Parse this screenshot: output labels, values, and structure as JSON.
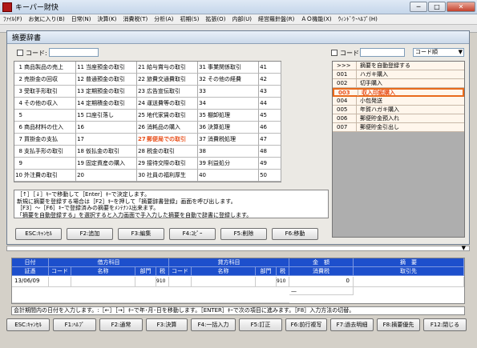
{
  "window": {
    "title": "キーパー財快"
  },
  "menu": [
    "ﾌｧｲﾙ(F)",
    "お気に入り(B)",
    "日常(N)",
    "決算(K)",
    "消費税(T)",
    "分析(A)",
    "初期(S)",
    "拡張(O)",
    "内部(U)",
    "経営羅針盤(R)",
    "ＡＯ機能(X)",
    "ｳｨﾝﾄﾞｳ･ﾍﾙﾌﾟ(H)"
  ],
  "dialog": {
    "title": "摘要辞書",
    "code_label": "コード:",
    "code_value": "",
    "right_code_label": "コード:",
    "right_code_value": "",
    "sort_select": "コード順",
    "grid": [
      [
        "1",
        "商品製品の売上",
        "11",
        "当座預金の取引",
        "21",
        "給与賞与の取引",
        "31",
        "事業関係取引",
        "41",
        ""
      ],
      [
        "2",
        "売掛金の回収",
        "12",
        "普通預金の取引",
        "22",
        "旅費交通費取引",
        "32",
        "その他の経費",
        "42",
        ""
      ],
      [
        "3",
        "受取手形取引",
        "13",
        "定期預金の取引",
        "23",
        "広告宣伝取引",
        "33",
        "",
        "43",
        ""
      ],
      [
        "4",
        "その他の収入",
        "14",
        "定期積金の取引",
        "24",
        "運送費等の取引",
        "34",
        "",
        "44",
        ""
      ],
      [
        "5",
        "",
        "15",
        "口座引落し",
        "25",
        "地代家賃の取引",
        "35",
        "棚卸処理",
        "45",
        ""
      ],
      [
        "6",
        "商品材料の仕入",
        "16",
        "",
        "26",
        "消耗品の購入",
        "36",
        "決算処理",
        "46",
        ""
      ],
      [
        "7",
        "買掛金の支払",
        "17",
        "",
        "27",
        "郵便局での取引",
        "37",
        "消費税処理",
        "47",
        ""
      ],
      [
        "8",
        "支払手形の取引",
        "18",
        "仮払金の取引",
        "28",
        "税金の取引",
        "38",
        "",
        "48",
        ""
      ],
      [
        "9",
        "",
        "19",
        "固定資産の購入",
        "29",
        "接待交際の取引",
        "39",
        "利益処分",
        "49",
        ""
      ],
      [
        "10",
        "外注費の取引",
        "20",
        "",
        "30",
        "社員の福利厚生",
        "40",
        "",
        "50",
        ""
      ]
    ],
    "help_lines": [
      "［↑］［↓］ｷｰで移動して［Enter］ｷｰで決定します。",
      "新規に摘要を登録する場合は［F2］ｷｰを押して「摘要辞書登録」画面を呼び出します。",
      "［F3］～［F6］ｷｰで登録済みの摘要をﾒﾝﾃﾅﾝｽ出来ます。",
      "「摘要を自動登録する」を選択すると入力画面で手入力した摘要を自動で辞書に登録します。"
    ],
    "buttons": [
      "ESC:ｷｬﾝｾﾙ",
      "F2:追加",
      "F3:編集",
      "F4:ｺﾋﾟｰ",
      "F5:削除",
      "F6:移動"
    ],
    "list": [
      {
        "code": ">>>",
        "name": "摘要を自動登録する"
      },
      {
        "code": "001",
        "name": "ハガキ購入"
      },
      {
        "code": "002",
        "name": "切手購入"
      },
      {
        "code": "003",
        "name": "収入印紙購入"
      },
      {
        "code": "004",
        "name": "小包発送"
      },
      {
        "code": "005",
        "name": "年賀ハガキ購入"
      },
      {
        "code": "006",
        "name": "郵便貯金預入れ"
      },
      {
        "code": "007",
        "name": "郵便貯金引出し"
      }
    ]
  },
  "entry": {
    "headers": {
      "date": "日付",
      "debit": "借方科目",
      "credit": "貸方科目",
      "amount": "金　額",
      "summary": "摘　要",
      "voucher": "証憑",
      "code1": "コード",
      "name1": "名称",
      "dept1": "部門",
      "tax1": "税",
      "code2": "コード",
      "name2": "名称",
      "dept2": "部門",
      "tax2": "税",
      "consumption_tax": "消費税",
      "client": "取引先"
    },
    "row": {
      "date": "13/06/09",
      "tax1": "910",
      "tax2": "910",
      "consumption": "0",
      "dash": "—"
    }
  },
  "status": "会計期間内の日付を入力します。:［←］［→］ｷｰで年･月･日を移動します。［ENTER］ｷｰで次の項目に進みます。［F8］入力方法の切替。",
  "fkeys": [
    "ESC:ｷｬﾝｾﾙ",
    "F1:ﾍﾙﾌﾟ",
    "F2:通常",
    "F3:決算",
    "F4:一括入力",
    "F5:訂正",
    "F6:前行複写",
    "F7:過去明細",
    "F8:摘要優先",
    "F12:閉じる"
  ],
  "colors": {
    "header_blue": "#1d4fcc",
    "highlight": "#e8501c",
    "list_bg": "#fff6ec"
  }
}
